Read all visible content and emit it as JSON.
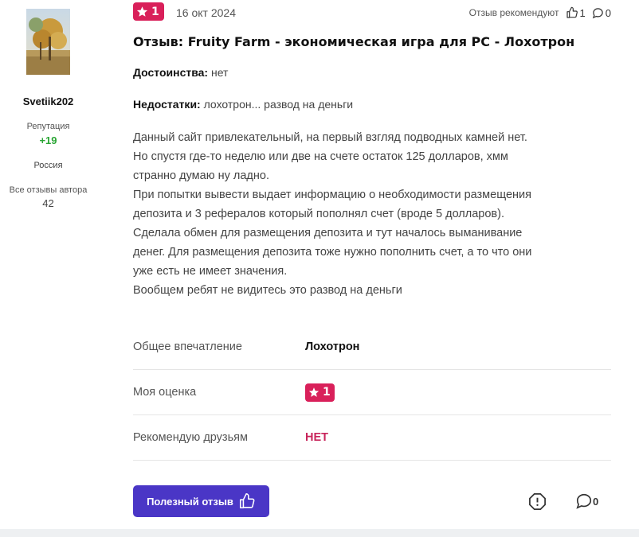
{
  "author": {
    "name": "Svetiik202",
    "reputation_label": "Репутация",
    "reputation_value": "+19",
    "country": "Россия",
    "all_reviews_label": "Все отзывы автора",
    "all_reviews_count": "42"
  },
  "review": {
    "rating": "1",
    "date": "16 окт 2024",
    "recommend_label": "Отзыв рекомендуют",
    "likes": "1",
    "comments": "0",
    "title": "Отзыв: Fruity Farm - экономическая игра для PC - Лохотрон",
    "pros_label": "Достоинства:",
    "pros": "нет",
    "cons_label": "Недостатки:",
    "cons": "лохотрон... развод на деньги",
    "body": [
      "Данный сайт привлекательный, на первый взгляд подводных камней нет.",
      "Но спустя где-то неделю или две на счете остаток 125 долларов, хмм",
      "странно думаю ну ладно.",
      "При попытки вывести выдает информацию о необходимости размещения",
      "депозита и 3 рефералов который пополнял счет (вроде 5 долларов).",
      "Сделала обмен для размещения депозита и тут началось выманивание",
      "денег. Для размещения депозита тоже нужно пополнить счет, а то что они",
      "уже есть не имеет значения.",
      "Вообщем ребят не видитесь это развод на деньги"
    ]
  },
  "summary": {
    "impression_label": "Общее впечатление",
    "impression_value": "Лохотрон",
    "rating_label": "Моя оценка",
    "rating_value": "1",
    "recommend_label": "Рекомендую друзьям",
    "recommend_value": "НЕТ"
  },
  "actions": {
    "useful_button": "Полезный отзыв",
    "comments_count": "0"
  },
  "colors": {
    "badge": "#d9205a",
    "button": "#4a36c6",
    "reputation": "#2aa534",
    "no": "#c8255b"
  }
}
